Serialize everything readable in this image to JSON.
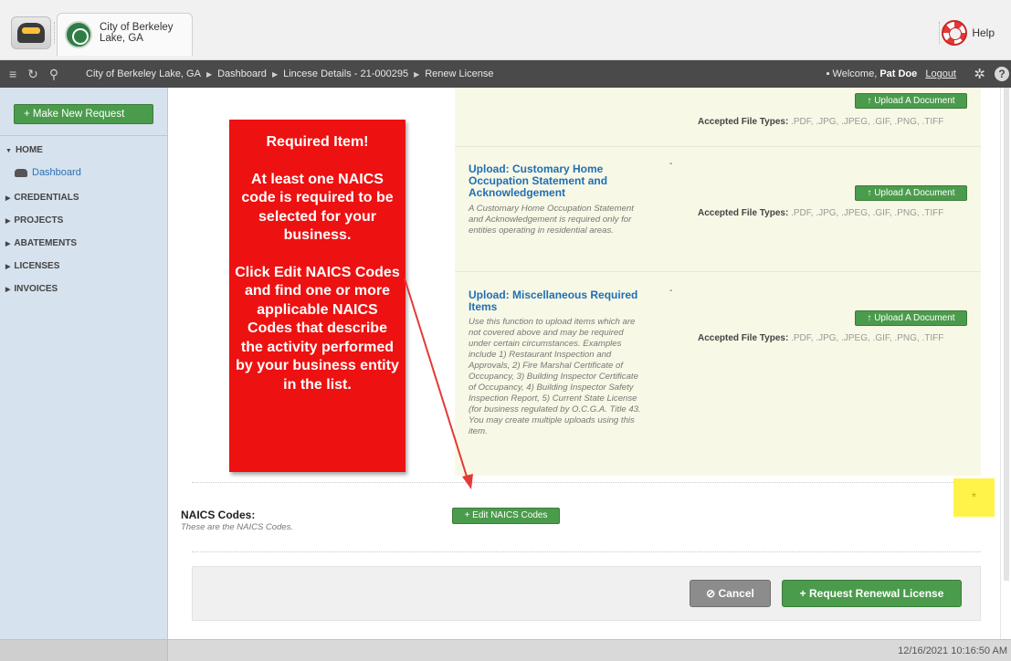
{
  "header": {
    "city_name": "City of Berkeley Lake, GA",
    "help_label": "Help"
  },
  "navbar": {
    "crumbs": [
      "City of Berkeley Lake, GA",
      "Dashboard",
      "Lincese Details - 21-000295",
      "Renew License"
    ],
    "welcome_prefix": "Welcome,",
    "user_name": "Pat Doe",
    "logout_label": "Logout"
  },
  "sidebar": {
    "new_request_label": "+ Make New Request",
    "home_label": "HOME",
    "dashboard_label": "Dashboard",
    "items": [
      "CREDENTIALS",
      "PROJECTS",
      "ABATEMENTS",
      "LICENSES",
      "INVOICES"
    ]
  },
  "uploads": {
    "button_label": "Upload A Document",
    "accepted_label": "Accepted File Types:",
    "file_types": ".PDF, .JPG, .JPEG, .GIF, .PNG, .TIFF",
    "dash": "-",
    "items": [
      {
        "title": "Upload: Customary Home Occupation Statement and Acknowledgement",
        "description": "A Customary Home Occupation Statement and Acknowledgement is required only for entities operating in residential areas."
      },
      {
        "title": "Upload: Miscellaneous Required Items",
        "description": "Use this function to upload items which are not covered above and may be required under certain circumstances. Examples include 1) Restaurant Inspection and Approvals, 2) Fire Marshal Certificate of Occupancy, 3) Building Inspector Certificate of Occupancy, 4) Building Inspector Safety Inspection Report, 5) Current State License (for business regulated by O.C.G.A. Title 43. You may create multiple uploads using this item."
      }
    ]
  },
  "naics": {
    "label": "NAICS Codes:",
    "sublabel": "These are the NAICS Codes.",
    "edit_button": "+ Edit NAICS Codes",
    "required_mark": "*"
  },
  "callout": {
    "title": "Required Item!",
    "para1": "At least one NAICS code is required to be selected for your business.",
    "para2": "Click Edit NAICS Codes and find one or more applicable NAICS Codes that describe the activity performed by your business entity in the list."
  },
  "actions": {
    "cancel_label": "Cancel",
    "renew_label": "Request Renewal License"
  },
  "footer": {
    "timestamp": "12/16/2021 10:16:50 AM"
  },
  "colors": {
    "accent_green": "#4b9b4c",
    "callout_red": "#ee1111",
    "link_blue": "#1f6fb5",
    "highlight_yellow": "#fff34a"
  }
}
